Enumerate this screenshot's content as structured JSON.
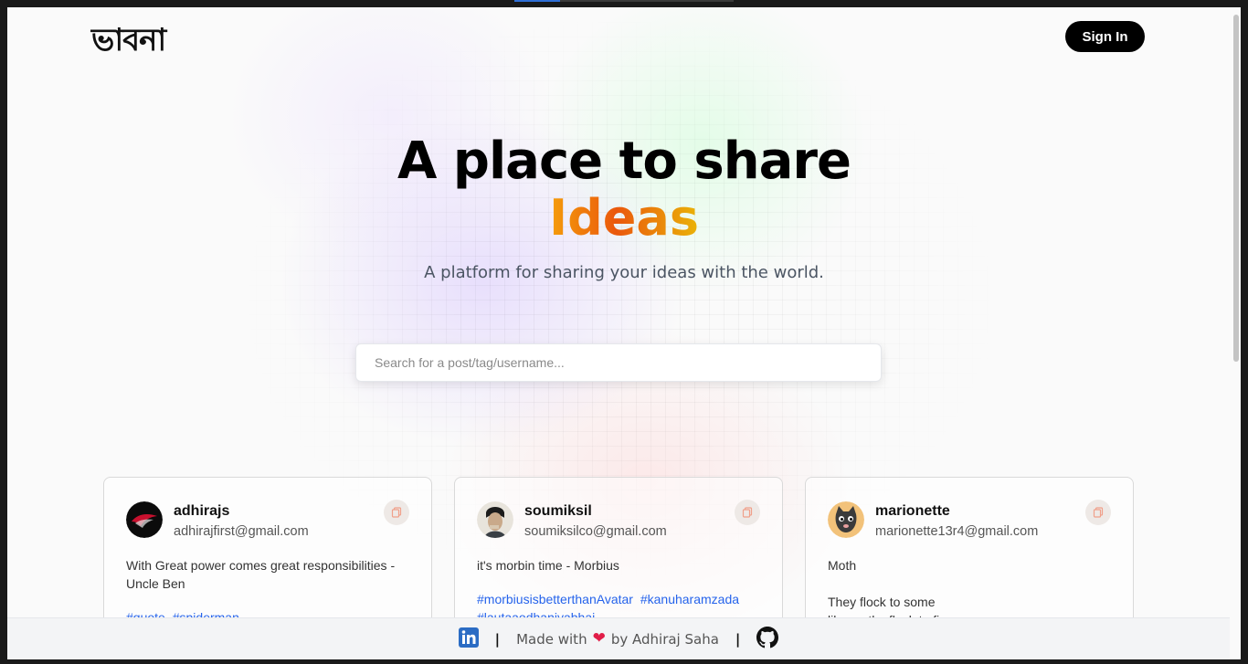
{
  "header": {
    "logo_text": "ভাবনা",
    "signin_label": "Sign In"
  },
  "hero": {
    "title": "A place to share",
    "accent": "Ideas",
    "subtitle": "A platform for sharing your ideas with the world."
  },
  "search": {
    "placeholder": "Search for a post/tag/username..."
  },
  "posts": [
    {
      "username": "adhirajs",
      "email": "adhirajfirst@gmail.com",
      "body": "With Great power comes great responsibilities - Uncle Ben",
      "tags": [
        "#quote",
        "#spiderman"
      ],
      "avatar_icon": "rog-logo-avatar"
    },
    {
      "username": "soumiksil",
      "email": "soumiksilco@gmail.com",
      "body": "it's morbin time - Morbius",
      "tags": [
        "#morbiusisbetterthanAvatar",
        "#kanuharamzada",
        "#lautaaodhaniyabhai"
      ],
      "avatar_icon": "portrait-avatar"
    },
    {
      "username": "marionette",
      "email": "marionette13r4@gmail.com",
      "body_line1": "Moth",
      "body_line2": "They flock to some",
      "body_line3": "like moths flock to fire",
      "avatar_icon": "cat-avatar"
    }
  ],
  "footer": {
    "made_with": "Made with",
    "by": "by Adhiraj Saha",
    "separator": "|",
    "linkedin_icon": "linkedin-icon",
    "github_icon": "github-icon"
  },
  "colors": {
    "accent_start": "#f59e0b",
    "accent_mid": "#ea580c",
    "link": "#2563eb",
    "heart": "#e11d48"
  }
}
